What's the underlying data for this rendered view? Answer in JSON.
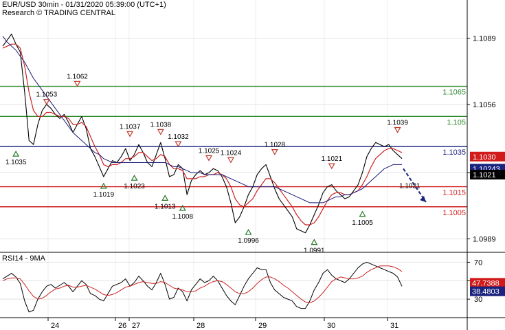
{
  "header": {
    "line1": "EUR/USD 30min - 01/31/2020 05:39:00 (UTC+1)",
    "line2": "Research © TRADING CENTRAL"
  },
  "rsi_panel": {
    "label": "RSI14 - 9MA"
  },
  "colors": {
    "background": "#ffffff",
    "price": "#000000",
    "ma_fast": "#cc2222",
    "ma_slow": "#1a1a7a",
    "resistance": "#2a8a2a",
    "pivot": "#1a237e",
    "support": "#d11a1a",
    "marker": "#c0392b",
    "marker_up": "#2a7a2a",
    "arrow": "#1a237e"
  },
  "chart_data": [
    {
      "type": "line",
      "title": "EUR/USD 30min - 01/31/2020 05:39:00 (UTC+1)",
      "ylim": [
        1.0983,
        1.1108
      ],
      "y_ticks": [
        1.1089,
        1.1056,
        1.1022,
        1.0989
      ],
      "x_ticks": [
        "24",
        "26",
        "27",
        "28",
        "29",
        "30",
        "31"
      ],
      "series": [
        {
          "style": "price",
          "values": [
            1.1085,
            1.1088,
            1.1091,
            1.1086,
            1.1082,
            1.1062,
            1.1038,
            1.1036,
            1.1046,
            1.1053,
            1.1056,
            1.1054,
            1.1051,
            1.1049,
            1.1051,
            1.1047,
            1.1042,
            1.1046,
            1.105,
            1.1044,
            1.1034,
            1.103,
            1.1025,
            1.102,
            1.1024,
            1.1028,
            1.1027,
            1.103,
            1.1034,
            1.1028,
            1.1031,
            1.1036,
            1.1032,
            1.1027,
            1.1025,
            1.1031,
            1.1037,
            1.1029,
            1.102,
            1.1021,
            1.1026,
            1.1024,
            1.1011,
            1.1018,
            1.1021,
            1.1023,
            1.1021,
            1.1022,
            1.1024,
            1.1023,
            1.102,
            1.1015,
            1.1007,
            1.0997,
            1.1,
            1.1005,
            1.1011,
            1.1015,
            1.1021,
            1.1024,
            1.1026,
            1.102,
            1.1014,
            1.1009,
            1.1006,
            1.1003,
            1.1,
            1.0994,
            1.0993,
            1.0992,
            1.0996,
            1.1001,
            1.1006,
            1.1012,
            1.1015,
            1.1016,
            1.1013,
            1.1011,
            1.1009,
            1.101,
            1.1013,
            1.1016,
            1.1022,
            1.103,
            1.1034,
            1.1037,
            1.1036,
            1.1035,
            1.1036,
            1.1033,
            1.1031,
            1.1029
          ],
          "width": 1.1
        },
        {
          "style": "ma_fast",
          "values": [
            1.1084,
            1.1085,
            1.1086,
            1.1086,
            1.1084,
            1.1075,
            1.1062,
            1.1053,
            1.105,
            1.105,
            1.1052,
            1.1052,
            1.1051,
            1.105,
            1.105,
            1.1049,
            1.1046,
            1.1046,
            1.1047,
            1.1045,
            1.104,
            1.1035,
            1.1031,
            1.1026,
            1.1025,
            1.1026,
            1.1026,
            1.1027,
            1.1029,
            1.1029,
            1.103,
            1.1032,
            1.1032,
            1.103,
            1.1028,
            1.1029,
            1.1031,
            1.103,
            1.1026,
            1.1024,
            1.1024,
            1.1023,
            1.1019,
            1.1019,
            1.1019,
            1.102,
            1.102,
            1.1021,
            1.1021,
            1.1022,
            1.1021,
            1.1019,
            1.1015,
            1.1009,
            1.1006,
            1.1005,
            1.1007,
            1.1009,
            1.1013,
            1.1016,
            1.1019,
            1.1019,
            1.1017,
            1.1014,
            1.1011,
            1.1008,
            1.1005,
            1.1001,
            1.0998,
            1.0996,
            1.0996,
            1.0997,
            1.1,
            1.1004,
            1.1008,
            1.1011,
            1.1012,
            1.1012,
            1.1011,
            1.1011,
            1.1012,
            1.1013,
            1.1016,
            1.102,
            1.1025,
            1.1029,
            1.1031,
            1.1033,
            1.1034,
            1.1034,
            1.1033,
            1.1032
          ],
          "width": 1.2
        },
        {
          "style": "ma_slow",
          "values": [
            1.109,
            1.1087,
            1.1085,
            1.1083,
            1.108,
            1.1077,
            1.1073,
            1.1069,
            1.1066,
            1.1063,
            1.106,
            1.1057,
            1.1054,
            1.1051,
            1.1048,
            1.1045,
            1.1042,
            1.104,
            1.1038,
            1.1036,
            1.1034,
            1.1032,
            1.1031,
            1.1029,
            1.1028,
            1.1027,
            1.1027,
            1.1027,
            1.1027,
            1.1027,
            1.1027,
            1.1027,
            1.1027,
            1.1027,
            1.1027,
            1.1027,
            1.1027,
            1.1027,
            1.1026,
            1.1025,
            1.1025,
            1.1024,
            1.1023,
            1.1022,
            1.1022,
            1.1022,
            1.1021,
            1.1021,
            1.1021,
            1.1021,
            1.1021,
            1.102,
            1.1019,
            1.1018,
            1.1017,
            1.1016,
            1.1015,
            1.1015,
            1.1015,
            1.1015,
            1.1015,
            1.1015,
            1.1015,
            1.1014,
            1.1013,
            1.1012,
            1.1011,
            1.101,
            1.1009,
            1.1008,
            1.1007,
            1.1007,
            1.1007,
            1.1007,
            1.1008,
            1.1009,
            1.101,
            1.101,
            1.1011,
            1.1011,
            1.1012,
            1.1013,
            1.1014,
            1.1016,
            1.1018,
            1.102,
            1.1022,
            1.1024,
            1.1025,
            1.1026,
            1.1026,
            1.1026
          ],
          "width": 1.0
        }
      ],
      "levels": [
        {
          "value": 1.1065,
          "label": "1.1065",
          "style": "resistance"
        },
        {
          "value": 1.105,
          "label": "1.105",
          "style": "resistance"
        },
        {
          "value": 1.1035,
          "label": "1.1035",
          "style": "pivot"
        },
        {
          "value": 1.1015,
          "label": "1.1015",
          "style": "support"
        },
        {
          "value": 1.1005,
          "label": "1.1005",
          "style": "support"
        }
      ],
      "price_badges": [
        {
          "value": 1.103,
          "label": "1.1030",
          "color": "#d11a1a"
        },
        {
          "value": 1.1024,
          "label": "1.10243",
          "color": "#1a237e"
        },
        {
          "value": 1.1021,
          "label": "1.1021",
          "color": "#000000"
        }
      ],
      "annotations": [
        {
          "i": 3,
          "price": 1.1035,
          "label": "1.1035",
          "dir": "up"
        },
        {
          "i": 10,
          "price": 1.1053,
          "label": "1.1053",
          "dir": "down"
        },
        {
          "i": 17,
          "price": 1.1062,
          "label": "1.1062",
          "dir": "down"
        },
        {
          "i": 23,
          "price": 1.1019,
          "label": "1.1019",
          "dir": "up"
        },
        {
          "i": 29,
          "price": 1.1037,
          "label": "1.1037",
          "dir": "down"
        },
        {
          "i": 30,
          "price": 1.1023,
          "label": "1.1023",
          "dir": "up"
        },
        {
          "i": 36,
          "price": 1.1038,
          "label": "1.1038",
          "dir": "down"
        },
        {
          "i": 37,
          "price": 1.1013,
          "label": "1.1013",
          "dir": "up"
        },
        {
          "i": 40,
          "price": 1.1032,
          "label": "1.1032",
          "dir": "down"
        },
        {
          "i": 41,
          "price": 1.1008,
          "label": "1.1008",
          "dir": "up"
        },
        {
          "i": 47,
          "price": 1.1025,
          "label": "1.1025",
          "dir": "down"
        },
        {
          "i": 52,
          "price": 1.1024,
          "label": "1.1024",
          "dir": "down"
        },
        {
          "i": 56,
          "price": 1.0996,
          "label": "1.0996",
          "dir": "up"
        },
        {
          "i": 62,
          "price": 1.1028,
          "label": "1.1028",
          "dir": "down"
        },
        {
          "i": 71,
          "price": 1.0991,
          "label": "1.0991",
          "dir": "up"
        },
        {
          "i": 75,
          "price": 1.1021,
          "label": "1.1021",
          "dir": "down"
        },
        {
          "i": 82,
          "price": 1.1005,
          "label": "1.1005",
          "dir": "up"
        },
        {
          "i": 90,
          "price": 1.1039,
          "label": "1.1039",
          "dir": "down"
        }
      ],
      "forecast": {
        "from": 1.1024,
        "to": 1.1008,
        "label": "1.1021"
      }
    },
    {
      "type": "line",
      "title": "RSI14 - 9MA",
      "ylim": [
        10,
        80
      ],
      "y_ticks": [
        70,
        50,
        30
      ],
      "series": [
        {
          "style": "price",
          "values": [
            52,
            55,
            58,
            54,
            47,
            28,
            16,
            18,
            30,
            38,
            44,
            46,
            42,
            45,
            48,
            44,
            38,
            44,
            50,
            46,
            36,
            34,
            30,
            28,
            36,
            44,
            46,
            48,
            52,
            44,
            48,
            55,
            50,
            44,
            40,
            48,
            58,
            46,
            30,
            32,
            42,
            38,
            28,
            40,
            46,
            52,
            48,
            50,
            55,
            50,
            42,
            34,
            28,
            24,
            34,
            44,
            52,
            58,
            64,
            62,
            62,
            48,
            40,
            36,
            32,
            30,
            28,
            22,
            20,
            20,
            28,
            40,
            48,
            58,
            62,
            56,
            52,
            50,
            48,
            52,
            58,
            64,
            68,
            70,
            68,
            66,
            64,
            62,
            60,
            58,
            54,
            44
          ],
          "width": 1.0
        },
        {
          "style": "ma_fast",
          "values": [
            50,
            52,
            53,
            53,
            52,
            46,
            39,
            33,
            30,
            31,
            34,
            38,
            41,
            42,
            44,
            45,
            43,
            43,
            44,
            45,
            43,
            41,
            38,
            35,
            34,
            35,
            37,
            40,
            43,
            44,
            46,
            48,
            49,
            48,
            47,
            47,
            49,
            48,
            45,
            42,
            41,
            40,
            38,
            38,
            39,
            42,
            44,
            47,
            49,
            50,
            49,
            46,
            42,
            38,
            36,
            36,
            38,
            42,
            47,
            51,
            54,
            54,
            52,
            49,
            45,
            42,
            38,
            34,
            30,
            27,
            26,
            28,
            32,
            37,
            43,
            49,
            52,
            54,
            53,
            52,
            52,
            53,
            55,
            59,
            62,
            64,
            66,
            66,
            66,
            65,
            63,
            60
          ],
          "width": 1.0
        }
      ],
      "badges": [
        {
          "value": 47.7,
          "label": "47.7388",
          "color": "#d11a1a"
        },
        {
          "value": 38.5,
          "label": "38.4803",
          "color": "#1a237e"
        }
      ]
    }
  ]
}
